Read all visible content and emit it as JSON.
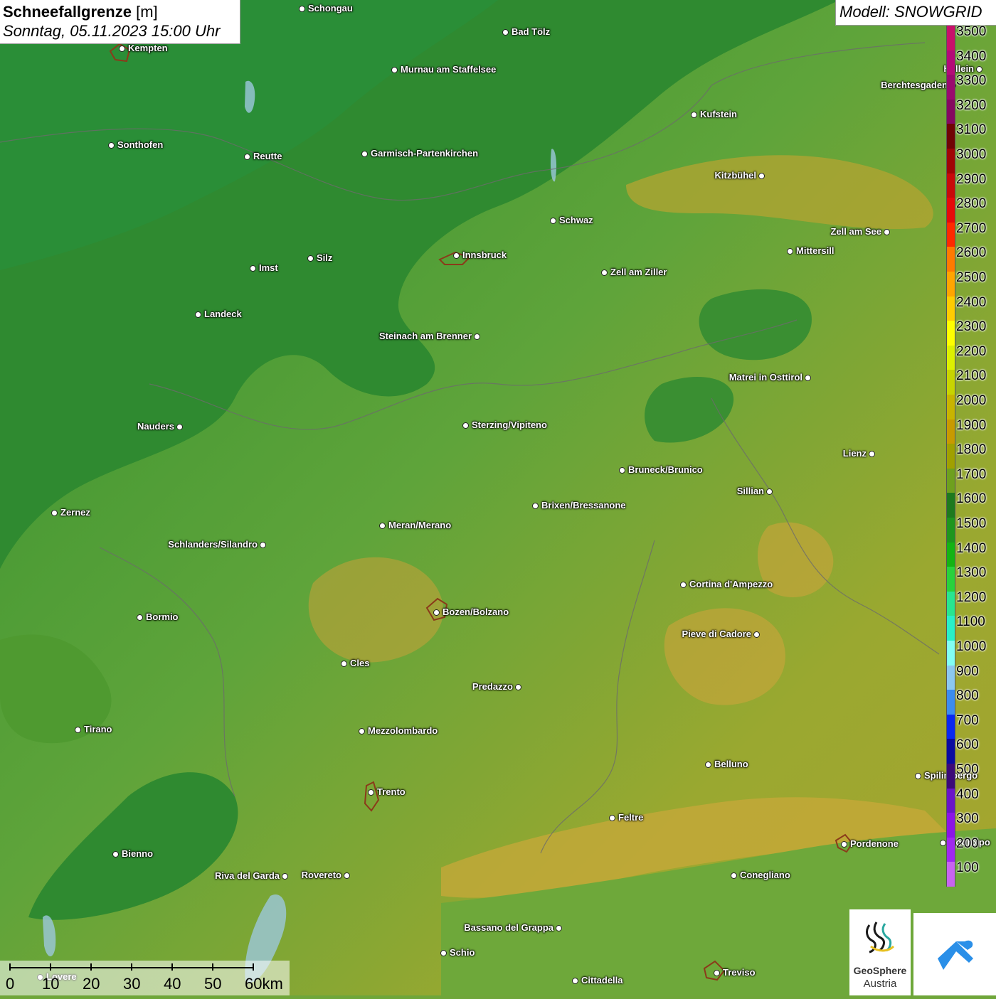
{
  "title": {
    "name": "Schneefallgrenze",
    "unit": "[m]",
    "datetime": "Sonntag, 05.11.2023 15:00 Uhr"
  },
  "model": "Modell: SNOWGRID",
  "legend": [
    {
      "label": "3500",
      "color": "#c8106a"
    },
    {
      "label": "3400",
      "color": "#b40a78"
    },
    {
      "label": "3300",
      "color": "#9a0a6e"
    },
    {
      "label": "3200",
      "color": "#850860"
    },
    {
      "label": "3100",
      "color": "#700505"
    },
    {
      "label": "3000",
      "color": "#a00505"
    },
    {
      "label": "2900",
      "color": "#c80a0a"
    },
    {
      "label": "2800",
      "color": "#e60a0a"
    },
    {
      "label": "2700",
      "color": "#ff2a00"
    },
    {
      "label": "2600",
      "color": "#ff7a00"
    },
    {
      "label": "2500",
      "color": "#ffa500"
    },
    {
      "label": "2400",
      "color": "#ffcc00"
    },
    {
      "label": "2300",
      "color": "#ffff00"
    },
    {
      "label": "2200",
      "color": "#ddf000"
    },
    {
      "label": "2100",
      "color": "#c8d400"
    },
    {
      "label": "2000",
      "color": "#c8b400"
    },
    {
      "label": "1900",
      "color": "#c89a00"
    },
    {
      "label": "1800",
      "color": "#a0a000"
    },
    {
      "label": "1700",
      "color": "#6ea01e"
    },
    {
      "label": "1600",
      "color": "#1e7a1e"
    },
    {
      "label": "1500",
      "color": "#1e961e"
    },
    {
      "label": "1400",
      "color": "#14b414"
    },
    {
      "label": "1300",
      "color": "#28d23c"
    },
    {
      "label": "1200",
      "color": "#28e690"
    },
    {
      "label": "1100",
      "color": "#28f0c8"
    },
    {
      "label": "1000",
      "color": "#82fff5"
    },
    {
      "label": "900",
      "color": "#8cc8f0"
    },
    {
      "label": "800",
      "color": "#3c8cf0"
    },
    {
      "label": "700",
      "color": "#0a28f0"
    },
    {
      "label": "600",
      "color": "#0a0aa0"
    },
    {
      "label": "500",
      "color": "#3c0a78"
    },
    {
      "label": "400",
      "color": "#6a14c8"
    },
    {
      "label": "300",
      "color": "#8c14e6"
    },
    {
      "label": "200",
      "color": "#a028f0"
    },
    {
      "label": "100",
      "color": "#c864f0"
    }
  ],
  "cities": [
    {
      "name": "Schongau",
      "side": "right"
    },
    {
      "name": "Bad Tölz",
      "side": "right"
    },
    {
      "name": "Kempten",
      "side": "right"
    },
    {
      "name": "Murnau am Staffelsee",
      "side": "right"
    },
    {
      "name": "Hallein",
      "side": "left"
    },
    {
      "name": "Berchtesgaden",
      "side": "left"
    },
    {
      "name": "Kufstein",
      "side": "right"
    },
    {
      "name": "Sonthofen",
      "side": "right"
    },
    {
      "name": "Reutte",
      "side": "right"
    },
    {
      "name": "Garmisch-Partenkirchen",
      "side": "right"
    },
    {
      "name": "Kitzbühel",
      "side": "left"
    },
    {
      "name": "Schwaz",
      "side": "right"
    },
    {
      "name": "Zell am See",
      "side": "left"
    },
    {
      "name": "Innsbruck",
      "side": "right"
    },
    {
      "name": "Mittersill",
      "side": "right"
    },
    {
      "name": "Imst",
      "side": "right"
    },
    {
      "name": "Silz",
      "side": "right"
    },
    {
      "name": "Zell am Ziller",
      "side": "right"
    },
    {
      "name": "Landeck",
      "side": "right"
    },
    {
      "name": "Steinach am Brenner",
      "side": "left"
    },
    {
      "name": "Matrei in Osttirol",
      "side": "left"
    },
    {
      "name": "Nauders",
      "side": "left"
    },
    {
      "name": "Sterzing/Vipiteno",
      "side": "right"
    },
    {
      "name": "Lienz",
      "side": "left"
    },
    {
      "name": "Bruneck/Brunico",
      "side": "right"
    },
    {
      "name": "Sillian",
      "side": "left"
    },
    {
      "name": "Zernez",
      "side": "right"
    },
    {
      "name": "Brixen/Bressanone",
      "side": "right"
    },
    {
      "name": "Schlanders/Silandro",
      "side": "left"
    },
    {
      "name": "Meran/Merano",
      "side": "right"
    },
    {
      "name": "Cortina d'Ampezzo",
      "side": "right"
    },
    {
      "name": "Bozen/Bolzano",
      "side": "right"
    },
    {
      "name": "Bormio",
      "side": "right"
    },
    {
      "name": "Pieve di Cadore",
      "side": "left"
    },
    {
      "name": "Cles",
      "side": "right"
    },
    {
      "name": "Predazzo",
      "side": "left"
    },
    {
      "name": "Tirano",
      "side": "right"
    },
    {
      "name": "Mezzolombardo",
      "side": "right"
    },
    {
      "name": "Belluno",
      "side": "right"
    },
    {
      "name": "Spilimbergo",
      "side": "right"
    },
    {
      "name": "Trento",
      "side": "right"
    },
    {
      "name": "Feltre",
      "side": "right"
    },
    {
      "name": "Pordenone",
      "side": "right"
    },
    {
      "name": "Codroipo",
      "side": "right"
    },
    {
      "name": "Bienno",
      "side": "right"
    },
    {
      "name": "Riva del Garda",
      "side": "left"
    },
    {
      "name": "Rovereto",
      "side": "left"
    },
    {
      "name": "Conegliano",
      "side": "right"
    },
    {
      "name": "Bassano del Grappa",
      "side": "left"
    },
    {
      "name": "Schio",
      "side": "right"
    },
    {
      "name": "Treviso",
      "side": "right"
    },
    {
      "name": "Cittadella",
      "side": "right"
    },
    {
      "name": "Lovere",
      "side": "right"
    }
  ],
  "scale": {
    "labels": [
      "0",
      "10",
      "20",
      "30",
      "40",
      "50",
      "60km"
    ]
  },
  "logos": {
    "geosphere_line1": "GeoSphere",
    "geosphere_line2": "Austria"
  }
}
